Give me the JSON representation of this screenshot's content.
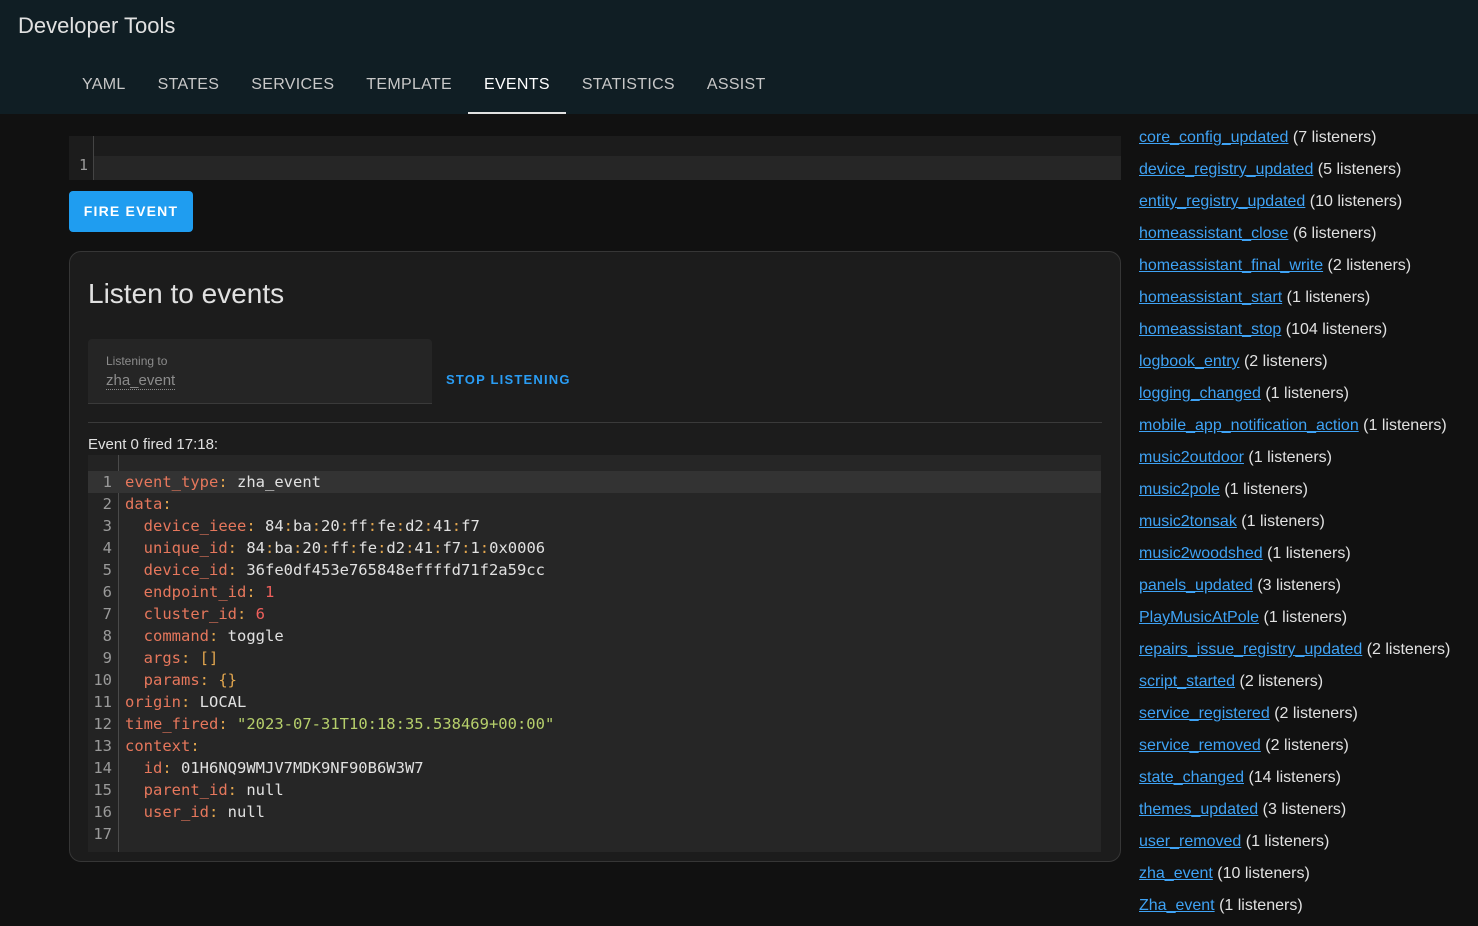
{
  "appbar": {
    "title": "Developer Tools",
    "tabs": [
      {
        "label": "YAML",
        "active": false
      },
      {
        "label": "STATES",
        "active": false
      },
      {
        "label": "SERVICES",
        "active": false
      },
      {
        "label": "TEMPLATE",
        "active": false
      },
      {
        "label": "EVENTS",
        "active": true
      },
      {
        "label": "STATISTICS",
        "active": false
      },
      {
        "label": "ASSIST",
        "active": false
      }
    ]
  },
  "fire": {
    "editor_line": "1",
    "button_label": "FIRE EVENT"
  },
  "listen": {
    "title": "Listen to events",
    "field_label": "Listening to",
    "field_value": "zha_event",
    "stop_label": "STOP LISTENING",
    "fired_text": "Event 0 fired 17:18:",
    "code_lines": [
      [
        {
          "t": "event_type",
          "c": "k"
        },
        {
          "t": ": ",
          "c": "p"
        },
        {
          "t": "zha_event",
          "c": "v"
        }
      ],
      [
        {
          "t": "data",
          "c": "k"
        },
        {
          "t": ":",
          "c": "p"
        }
      ],
      [
        {
          "t": "  device_ieee",
          "c": "k"
        },
        {
          "t": ": ",
          "c": "p"
        },
        {
          "t": "84",
          "c": "v"
        },
        {
          "t": ":",
          "c": "p"
        },
        {
          "t": "ba",
          "c": "v"
        },
        {
          "t": ":",
          "c": "p"
        },
        {
          "t": "20",
          "c": "v"
        },
        {
          "t": ":",
          "c": "p"
        },
        {
          "t": "ff",
          "c": "v"
        },
        {
          "t": ":",
          "c": "p"
        },
        {
          "t": "fe",
          "c": "v"
        },
        {
          "t": ":",
          "c": "p"
        },
        {
          "t": "d2",
          "c": "v"
        },
        {
          "t": ":",
          "c": "p"
        },
        {
          "t": "41",
          "c": "v"
        },
        {
          "t": ":",
          "c": "p"
        },
        {
          "t": "f7",
          "c": "v"
        }
      ],
      [
        {
          "t": "  unique_id",
          "c": "k"
        },
        {
          "t": ": ",
          "c": "p"
        },
        {
          "t": "84",
          "c": "v"
        },
        {
          "t": ":",
          "c": "p"
        },
        {
          "t": "ba",
          "c": "v"
        },
        {
          "t": ":",
          "c": "p"
        },
        {
          "t": "20",
          "c": "v"
        },
        {
          "t": ":",
          "c": "p"
        },
        {
          "t": "ff",
          "c": "v"
        },
        {
          "t": ":",
          "c": "p"
        },
        {
          "t": "fe",
          "c": "v"
        },
        {
          "t": ":",
          "c": "p"
        },
        {
          "t": "d2",
          "c": "v"
        },
        {
          "t": ":",
          "c": "p"
        },
        {
          "t": "41",
          "c": "v"
        },
        {
          "t": ":",
          "c": "p"
        },
        {
          "t": "f7",
          "c": "v"
        },
        {
          "t": ":",
          "c": "p"
        },
        {
          "t": "1",
          "c": "v"
        },
        {
          "t": ":",
          "c": "p"
        },
        {
          "t": "0x0006",
          "c": "v"
        }
      ],
      [
        {
          "t": "  device_id",
          "c": "k"
        },
        {
          "t": ": ",
          "c": "p"
        },
        {
          "t": "36fe0df453e765848effffd71f2a59cc",
          "c": "v"
        }
      ],
      [
        {
          "t": "  endpoint_id",
          "c": "k"
        },
        {
          "t": ": ",
          "c": "p"
        },
        {
          "t": "1",
          "c": "n"
        }
      ],
      [
        {
          "t": "  cluster_id",
          "c": "k"
        },
        {
          "t": ": ",
          "c": "p"
        },
        {
          "t": "6",
          "c": "n"
        }
      ],
      [
        {
          "t": "  command",
          "c": "k"
        },
        {
          "t": ": ",
          "c": "p"
        },
        {
          "t": "toggle",
          "c": "v"
        }
      ],
      [
        {
          "t": "  args",
          "c": "k"
        },
        {
          "t": ": ",
          "c": "p"
        },
        {
          "t": "[]",
          "c": "p"
        }
      ],
      [
        {
          "t": "  params",
          "c": "k"
        },
        {
          "t": ": ",
          "c": "p"
        },
        {
          "t": "{}",
          "c": "p"
        }
      ],
      [
        {
          "t": "origin",
          "c": "k"
        },
        {
          "t": ": ",
          "c": "p"
        },
        {
          "t": "LOCAL",
          "c": "v"
        }
      ],
      [
        {
          "t": "time_fired",
          "c": "k"
        },
        {
          "t": ": ",
          "c": "p"
        },
        {
          "t": "\"2023-07-31T10:18:35.538469+00:00\"",
          "c": "s"
        }
      ],
      [
        {
          "t": "context",
          "c": "k"
        },
        {
          "t": ":",
          "c": "p"
        }
      ],
      [
        {
          "t": "  id",
          "c": "k"
        },
        {
          "t": ": ",
          "c": "p"
        },
        {
          "t": "01H6NQ9WMJV7MDK9NF90B6W3W7",
          "c": "v"
        }
      ],
      [
        {
          "t": "  parent_id",
          "c": "k"
        },
        {
          "t": ": ",
          "c": "p"
        },
        {
          "t": "null",
          "c": "v"
        }
      ],
      [
        {
          "t": "  user_id",
          "c": "k"
        },
        {
          "t": ": ",
          "c": "p"
        },
        {
          "t": "null",
          "c": "v"
        }
      ],
      []
    ]
  },
  "events": [
    {
      "name": "core_config_updated",
      "count": "(7 listeners)"
    },
    {
      "name": "device_registry_updated",
      "count": "(5 listeners)"
    },
    {
      "name": "entity_registry_updated",
      "count": "(10 listeners)"
    },
    {
      "name": "homeassistant_close",
      "count": "(6 listeners)"
    },
    {
      "name": "homeassistant_final_write",
      "count": "(2 listeners)"
    },
    {
      "name": "homeassistant_start",
      "count": "(1 listeners)"
    },
    {
      "name": "homeassistant_stop",
      "count": "(104 listeners)"
    },
    {
      "name": "logbook_entry",
      "count": "(2 listeners)"
    },
    {
      "name": "logging_changed",
      "count": "(1 listeners)"
    },
    {
      "name": "mobile_app_notification_action",
      "count": "(1 listeners)"
    },
    {
      "name": "music2outdoor",
      "count": "(1 listeners)"
    },
    {
      "name": "music2pole",
      "count": "(1 listeners)"
    },
    {
      "name": "music2tonsak",
      "count": "(1 listeners)"
    },
    {
      "name": "music2woodshed",
      "count": "(1 listeners)"
    },
    {
      "name": "panels_updated",
      "count": "(3 listeners)"
    },
    {
      "name": "PlayMusicAtPole",
      "count": "(1 listeners)"
    },
    {
      "name": "repairs_issue_registry_updated",
      "count": "(2 listeners)"
    },
    {
      "name": "script_started",
      "count": "(2 listeners)"
    },
    {
      "name": "service_registered",
      "count": "(2 listeners)"
    },
    {
      "name": "service_removed",
      "count": "(2 listeners)"
    },
    {
      "name": "state_changed",
      "count": "(14 listeners)"
    },
    {
      "name": "themes_updated",
      "count": "(3 listeners)"
    },
    {
      "name": "user_removed",
      "count": "(1 listeners)"
    },
    {
      "name": "zha_event",
      "count": "(10 listeners)"
    },
    {
      "name": "Zha_event",
      "count": "(1 listeners)"
    }
  ],
  "colors": {
    "appbar_bg": "#101e24",
    "accent": "#1f9df0",
    "link": "#3fa3f5",
    "yaml_key": "#e6775c",
    "yaml_string": "#b6cf6b",
    "yaml_number": "#f0605c"
  }
}
